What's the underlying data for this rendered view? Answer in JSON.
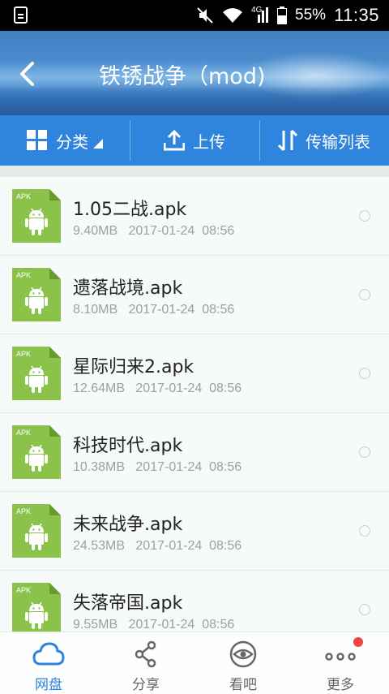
{
  "status_bar": {
    "network": "4G",
    "battery_pct": "55%",
    "time": "11:35"
  },
  "header": {
    "title": "铁锈战争（mod)"
  },
  "toolbar": {
    "classify_label": "分类",
    "upload_label": "上传",
    "transfer_label": "传输列表"
  },
  "files": [
    {
      "name": "1.05二战.apk",
      "size": "9.40MB",
      "date": "2017-01-24  08:56",
      "icon_label": "APK"
    },
    {
      "name": "遗落战境.apk",
      "size": "8.10MB",
      "date": "2017-01-24  08:56",
      "icon_label": "APK"
    },
    {
      "name": "星际归来2.apk",
      "size": "12.64MB",
      "date": "2017-01-24  08:56",
      "icon_label": "APK"
    },
    {
      "name": "科技时代.apk",
      "size": "10.38MB",
      "date": "2017-01-24  08:56",
      "icon_label": "APK"
    },
    {
      "name": "未来战争.apk",
      "size": "24.53MB",
      "date": "2017-01-24  08:56",
      "icon_label": "APK"
    },
    {
      "name": "失落帝国.apk",
      "size": "9.55MB",
      "date": "2017-01-24  08:56",
      "icon_label": "APK"
    }
  ],
  "bottom_nav": [
    {
      "label": "网盘",
      "icon": "cloud-icon",
      "active": true
    },
    {
      "label": "分享",
      "icon": "share-icon",
      "active": false
    },
    {
      "label": "看吧",
      "icon": "eye-icon",
      "active": false
    },
    {
      "label": "更多",
      "icon": "more-icon",
      "active": false,
      "badge": true
    }
  ],
  "colors": {
    "accent": "#2f84de",
    "apk_green": "#8bc34a",
    "badge_red": "#f24444"
  }
}
